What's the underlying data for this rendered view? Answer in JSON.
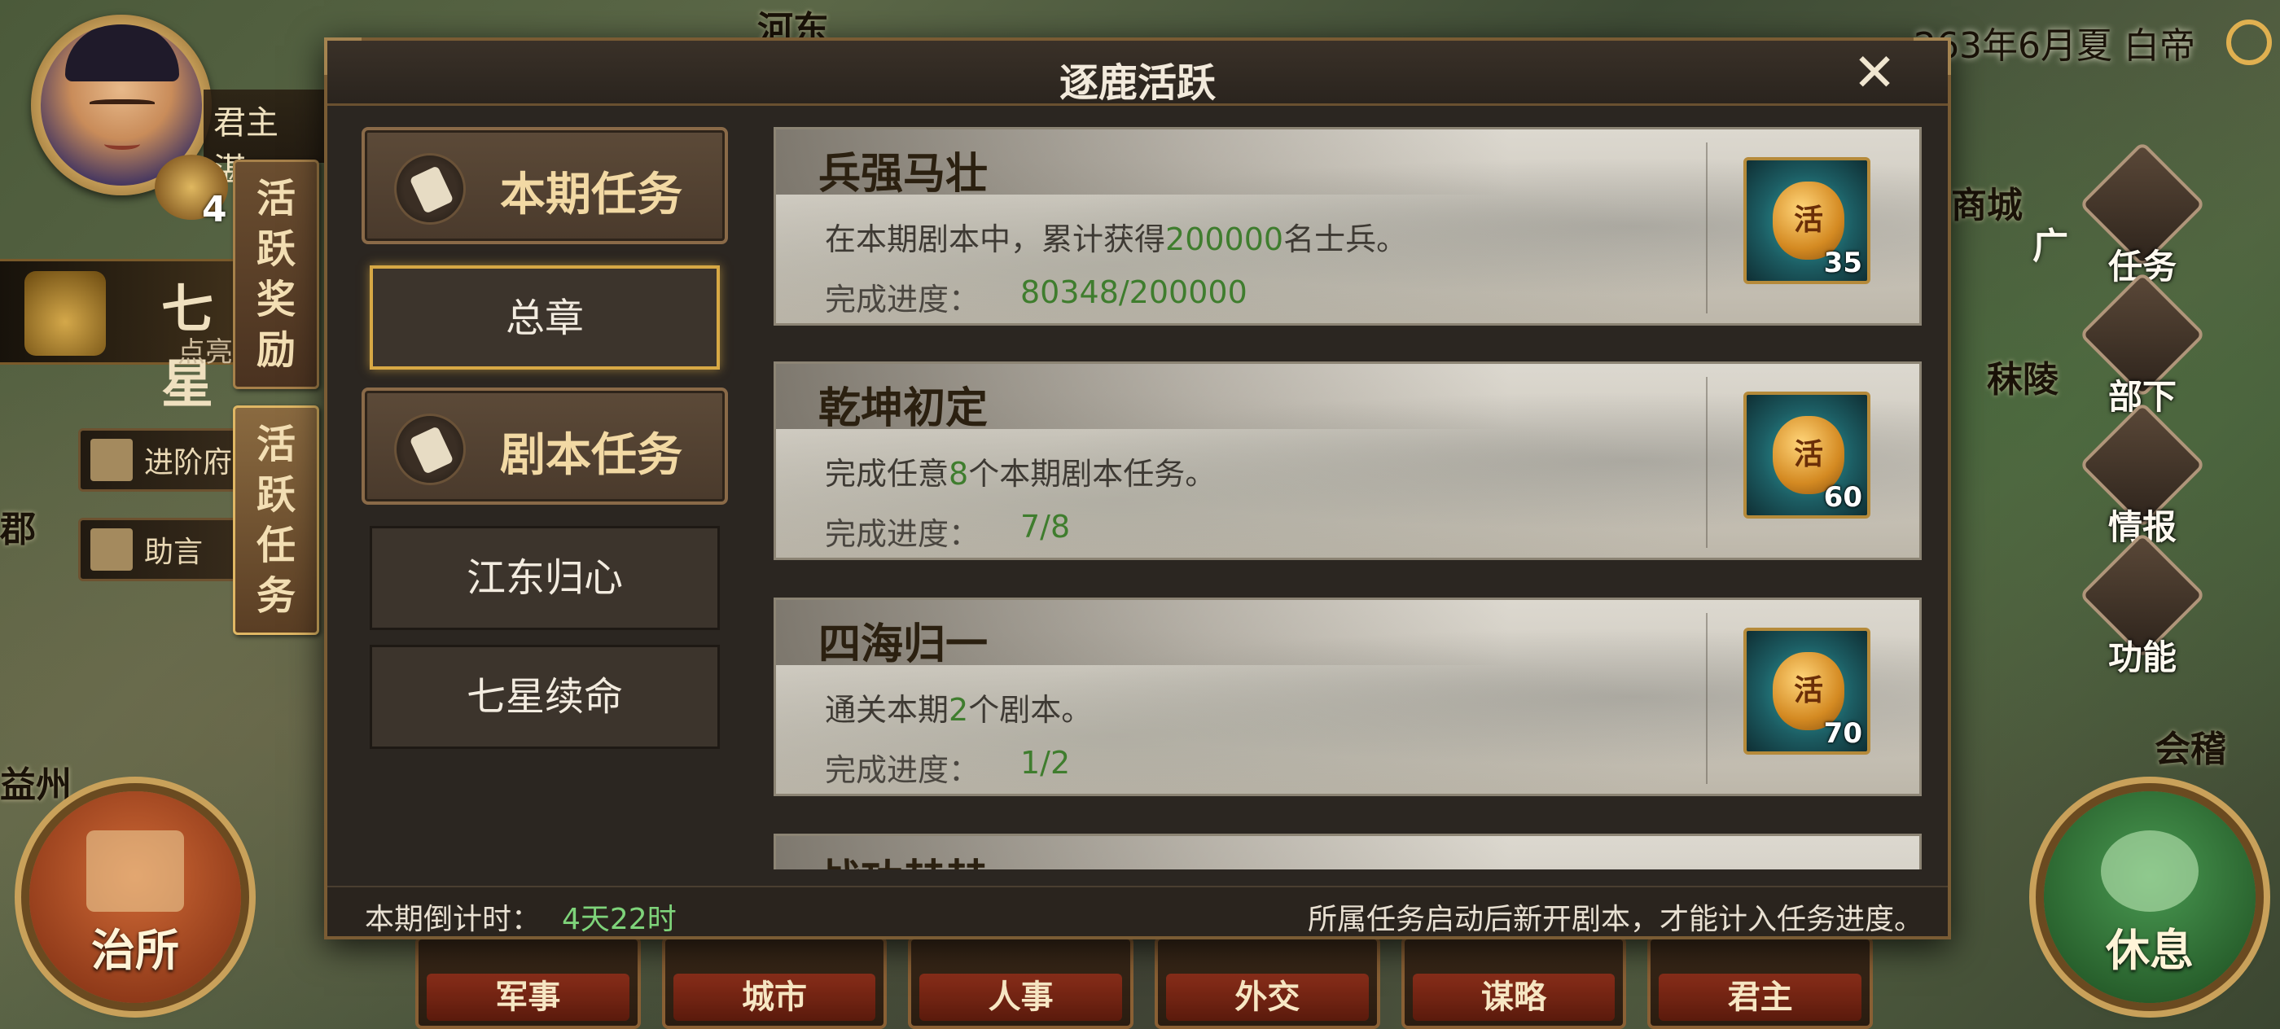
{
  "map": {
    "labels": [
      "河东",
      "商城",
      "广",
      "秣陵",
      "益州",
      "会稽",
      "郡"
    ]
  },
  "player": {
    "title": "君主",
    "name_partial": "湛",
    "level": "4",
    "seal_title": "七星",
    "seal_sub": "点亮"
  },
  "left_panel": {
    "side_tabs": [
      {
        "label": [
          "活",
          "跃",
          "奖",
          "励"
        ]
      },
      {
        "label": [
          "活",
          "跃",
          "任",
          "务"
        ]
      }
    ],
    "buttons": [
      {
        "label": "进阶府"
      },
      {
        "label": "助言"
      }
    ]
  },
  "top_right": {
    "date": "263年6月夏 白帝",
    "nav": [
      {
        "label": "任务",
        "icon": "scroll-icon"
      },
      {
        "label": "部下",
        "icon": "helmet-icon"
      },
      {
        "label": "情报",
        "icon": "book-icon"
      },
      {
        "label": "功能",
        "icon": "gear-icon"
      }
    ]
  },
  "bottom": {
    "gov_label": "治所",
    "rest_label": "休息",
    "tabs": [
      "军事",
      "城市",
      "人事",
      "外交",
      "谋略",
      "君主"
    ]
  },
  "dialog": {
    "title": "逐鹿活跃",
    "categories": [
      {
        "label": "本期任务"
      },
      {
        "label": "剧本任务"
      }
    ],
    "sub_items": [
      "总章",
      "江东归心",
      "七星续命"
    ],
    "tasks": [
      {
        "title": "兵强马壮",
        "desc_pre": "在本期剧本中，累计获得",
        "desc_hl": "200000",
        "desc_post": "名士兵。",
        "progress_label": "完成进度：",
        "progress_value": "80348/200000",
        "reward_glyph": "活",
        "reward_count": "35"
      },
      {
        "title": "乾坤初定",
        "desc_pre": "完成任意",
        "desc_hl": "8",
        "desc_post": "个本期剧本任务。",
        "progress_label": "完成进度：",
        "progress_value": "7/8",
        "reward_glyph": "活",
        "reward_count": "60"
      },
      {
        "title": "四海归一",
        "desc_pre": "通关本期",
        "desc_hl": "2",
        "desc_post": "个剧本。",
        "progress_label": "完成进度：",
        "progress_value": "1/2",
        "reward_glyph": "活",
        "reward_count": "70"
      },
      {
        "title": "战功赫赫",
        "desc_pre": "",
        "desc_hl": "",
        "desc_post": "",
        "progress_label": "",
        "progress_value": "",
        "reward_glyph": "",
        "reward_count": ""
      }
    ],
    "footer": {
      "countdown_label": "本期倒计时：",
      "countdown_value": "4天22时",
      "note": "所属任务启动后新开剧本，才能计入任务进度。"
    }
  },
  "colors": {
    "accent_green": "#3f7d2e",
    "timer_green": "#7ed37a",
    "gold_border": "#d7a845"
  }
}
